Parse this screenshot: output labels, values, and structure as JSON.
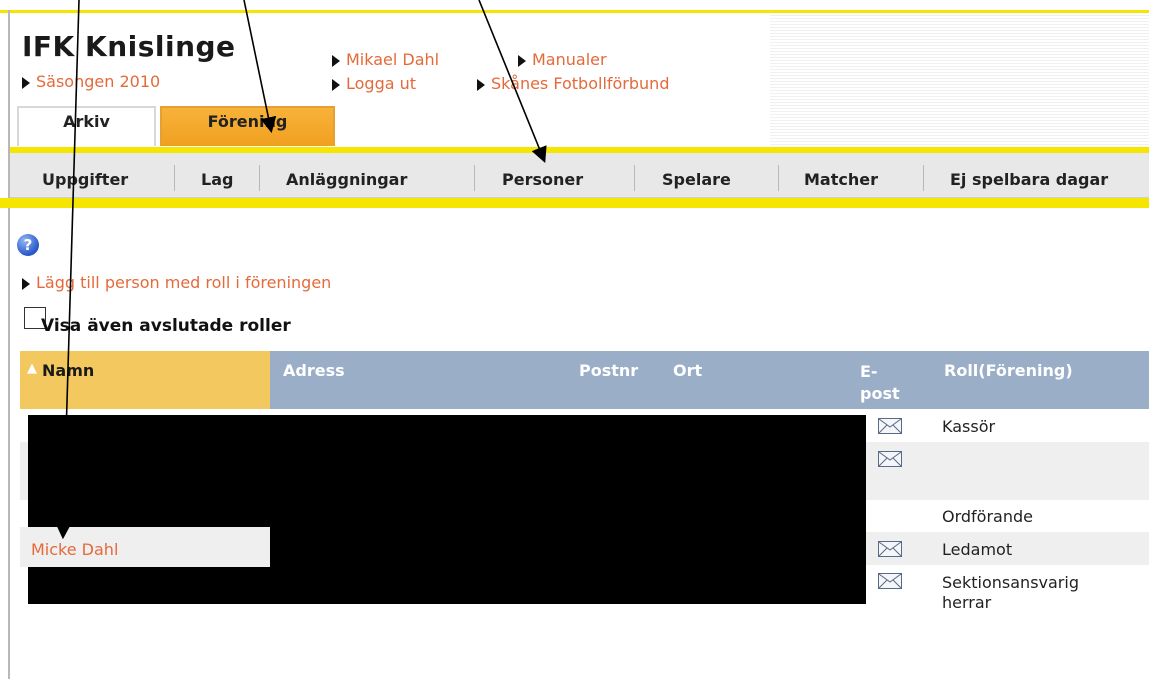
{
  "header": {
    "club_name": "IFK Knislinge",
    "season_link": "Säsongen 2010",
    "user_link": "Mikael Dahl",
    "manuals_link": "Manualer",
    "logout_link": "Logga ut",
    "federation_link": "Skånes Fotbollförbund"
  },
  "tabs": [
    {
      "label": "Arkiv",
      "active": false
    },
    {
      "label": "Förening",
      "active": true
    }
  ],
  "nav": {
    "items": [
      "Uppgifter",
      "Lag",
      "Anläggningar",
      "Personer",
      "Spelare",
      "Matcher",
      "Ej spelbara dagar"
    ]
  },
  "content": {
    "help_icon": "question-icon",
    "add_person_link": "Lägg till person med roll i föreningen",
    "show_ended_label": "Visa även avslutade roller",
    "show_ended_checked": false
  },
  "table": {
    "headers": {
      "name": "Namn",
      "address": "Adress",
      "postnr": "Postnr",
      "ort": "Ort",
      "email_line1": "E-",
      "email_line2": "post",
      "role": "Roll(Förening)"
    },
    "rows": [
      {
        "name": "",
        "has_email": true,
        "role": "Kassör"
      },
      {
        "name": "",
        "has_email": true,
        "role": ""
      },
      {
        "name": "",
        "has_email": false,
        "role": "Ordförande"
      },
      {
        "name": "Micke Dahl",
        "has_email": true,
        "role": "Ledamot"
      },
      {
        "name": "",
        "has_email": true,
        "role_line1": "Sektionsansvarig",
        "role_line2": "herrar"
      }
    ]
  },
  "colors": {
    "accent_yellow": "#f4e600",
    "active_tab": "#f0a020",
    "link": "#e46a3a",
    "table_header": "#9aaec8",
    "sorted_header": "#f3c85e"
  }
}
